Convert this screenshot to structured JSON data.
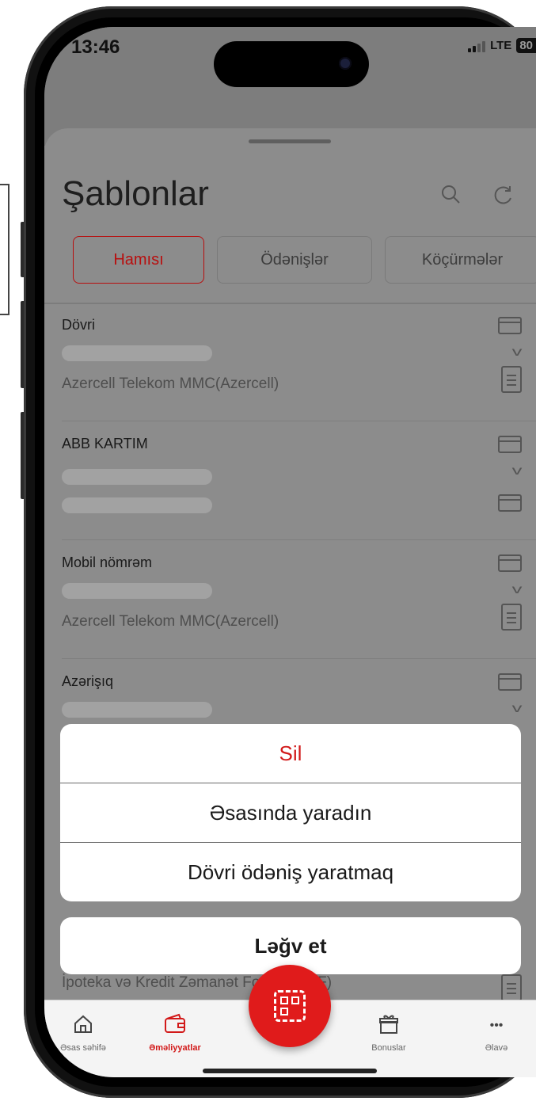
{
  "status": {
    "time": "13:46",
    "network": "LTE",
    "battery": "80"
  },
  "header": {
    "title": "Şablonlar",
    "search_icon": "search-icon",
    "refresh_icon": "refresh-icon"
  },
  "tabs": [
    {
      "label": "Hamısı",
      "active": true
    },
    {
      "label": "Ödənişlər",
      "active": false
    },
    {
      "label": "Köçürmələr",
      "active": false
    }
  ],
  "templates": [
    {
      "name": "Dövri",
      "provider": "Azercell Telekom MMC(Azercell)"
    },
    {
      "name": "ABB KARTIM",
      "provider": ""
    },
    {
      "name": "Mobil nömrəm",
      "provider": "Azercell Telekom MMC(Azercell)"
    },
    {
      "name": "Azərişıq",
      "provider": ""
    }
  ],
  "behind_text": "İpoteka və Kredit Zəmanət Fondu (IKZF)",
  "action_sheet": {
    "actions": [
      "Sil",
      "Əsasında yaradın",
      "Dövri ödəniş yaratmaq"
    ],
    "cancel": "Ləğv et"
  },
  "nav": {
    "items": [
      {
        "label": "Əsas səhifə",
        "icon": "home-icon"
      },
      {
        "label": "Əməliyyatlar",
        "icon": "wallet-icon",
        "active": true
      },
      {
        "label": "Bonuslar",
        "icon": "gift-icon"
      },
      {
        "label": "Əlavə",
        "icon": "more-icon"
      }
    ],
    "fab_icon": "qr-scan-icon"
  },
  "colors": {
    "accent": "#e01b1b",
    "danger_text": "#d21919"
  }
}
